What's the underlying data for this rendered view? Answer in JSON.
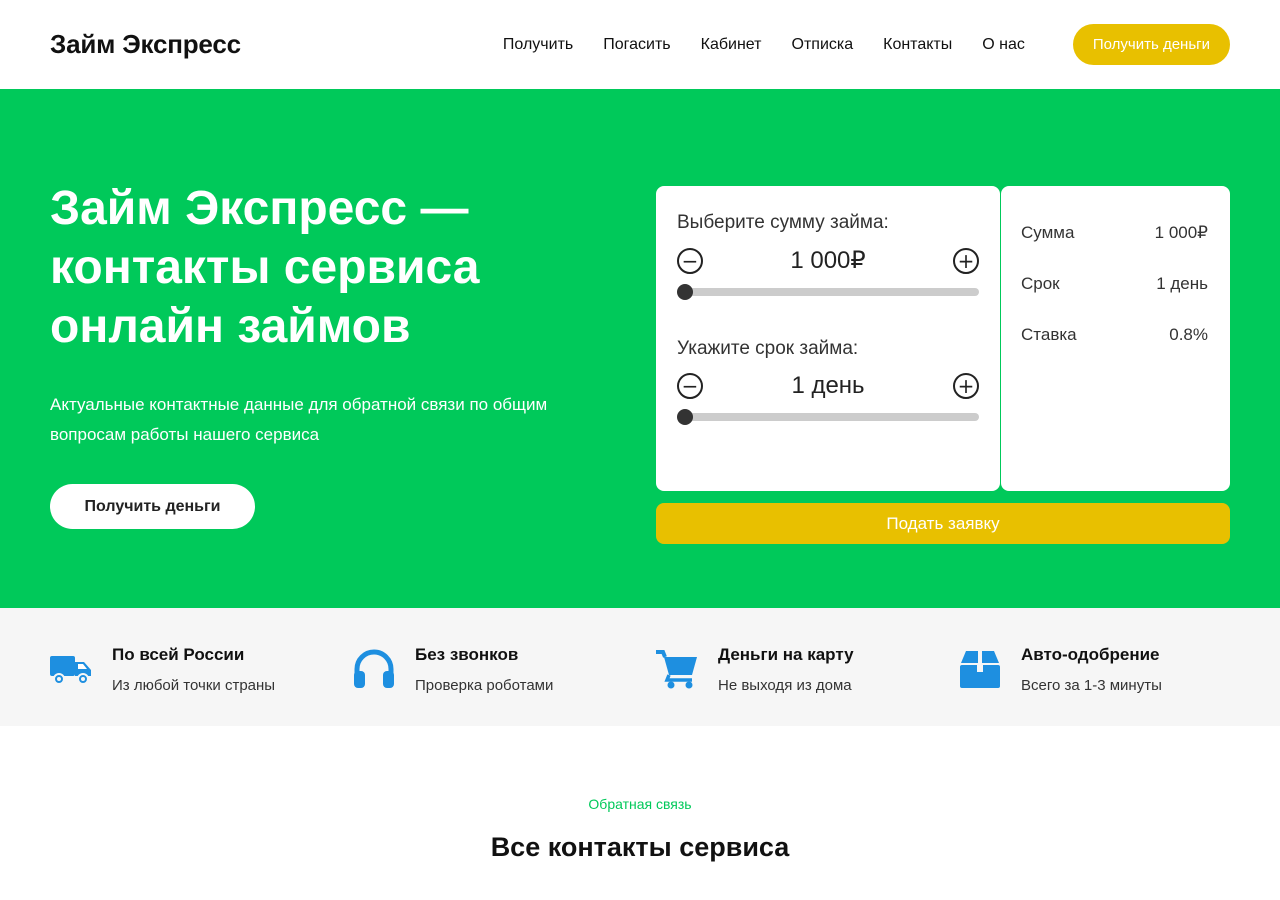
{
  "header": {
    "logo": "Займ Экспресс",
    "nav": [
      "Получить",
      "Погасить",
      "Кабинет",
      "Отписка",
      "Контакты",
      "О нас"
    ],
    "cta": "Получить деньги"
  },
  "hero": {
    "title": "Займ Экспресс — контакты сервиса онлайн займов",
    "subtitle": "Актуальные контактные данные для обратной связи по общим вопросам работы нашего сервиса",
    "button": "Получить деньги"
  },
  "calculator": {
    "amount_label": "Выберите сумму займа:",
    "amount_value": "1 000₽",
    "amount_slider_fraction": 0,
    "term_label": "Укажите срок займа:",
    "term_value": "1 день",
    "term_slider_fraction": 0,
    "minus_symbol": "−",
    "plus_symbol": "+",
    "submit": "Подать заявку"
  },
  "summary": {
    "rows": [
      {
        "label": "Сумма",
        "value": "1 000₽"
      },
      {
        "label": "Срок",
        "value": "1 день"
      },
      {
        "label": "Ставка",
        "value": "0.8%"
      }
    ]
  },
  "features": [
    {
      "icon": "truck-icon",
      "title": "По всей России",
      "desc": "Из любой точки страны"
    },
    {
      "icon": "headphones-icon",
      "title": "Без звонков",
      "desc": "Проверка роботами"
    },
    {
      "icon": "cart-icon",
      "title": "Деньги на карту",
      "desc": "Не выходя из дома"
    },
    {
      "icon": "box-icon",
      "title": "Авто-одобрение",
      "desc": "Всего за 1-3 минуты"
    }
  ],
  "contacts_section": {
    "eyebrow": "Обратная связь",
    "title": "Все контакты сервиса"
  },
  "colors": {
    "brand_green": "#00c95a",
    "accent_yellow": "#e8c000",
    "icon_blue": "#1e8fe0"
  }
}
